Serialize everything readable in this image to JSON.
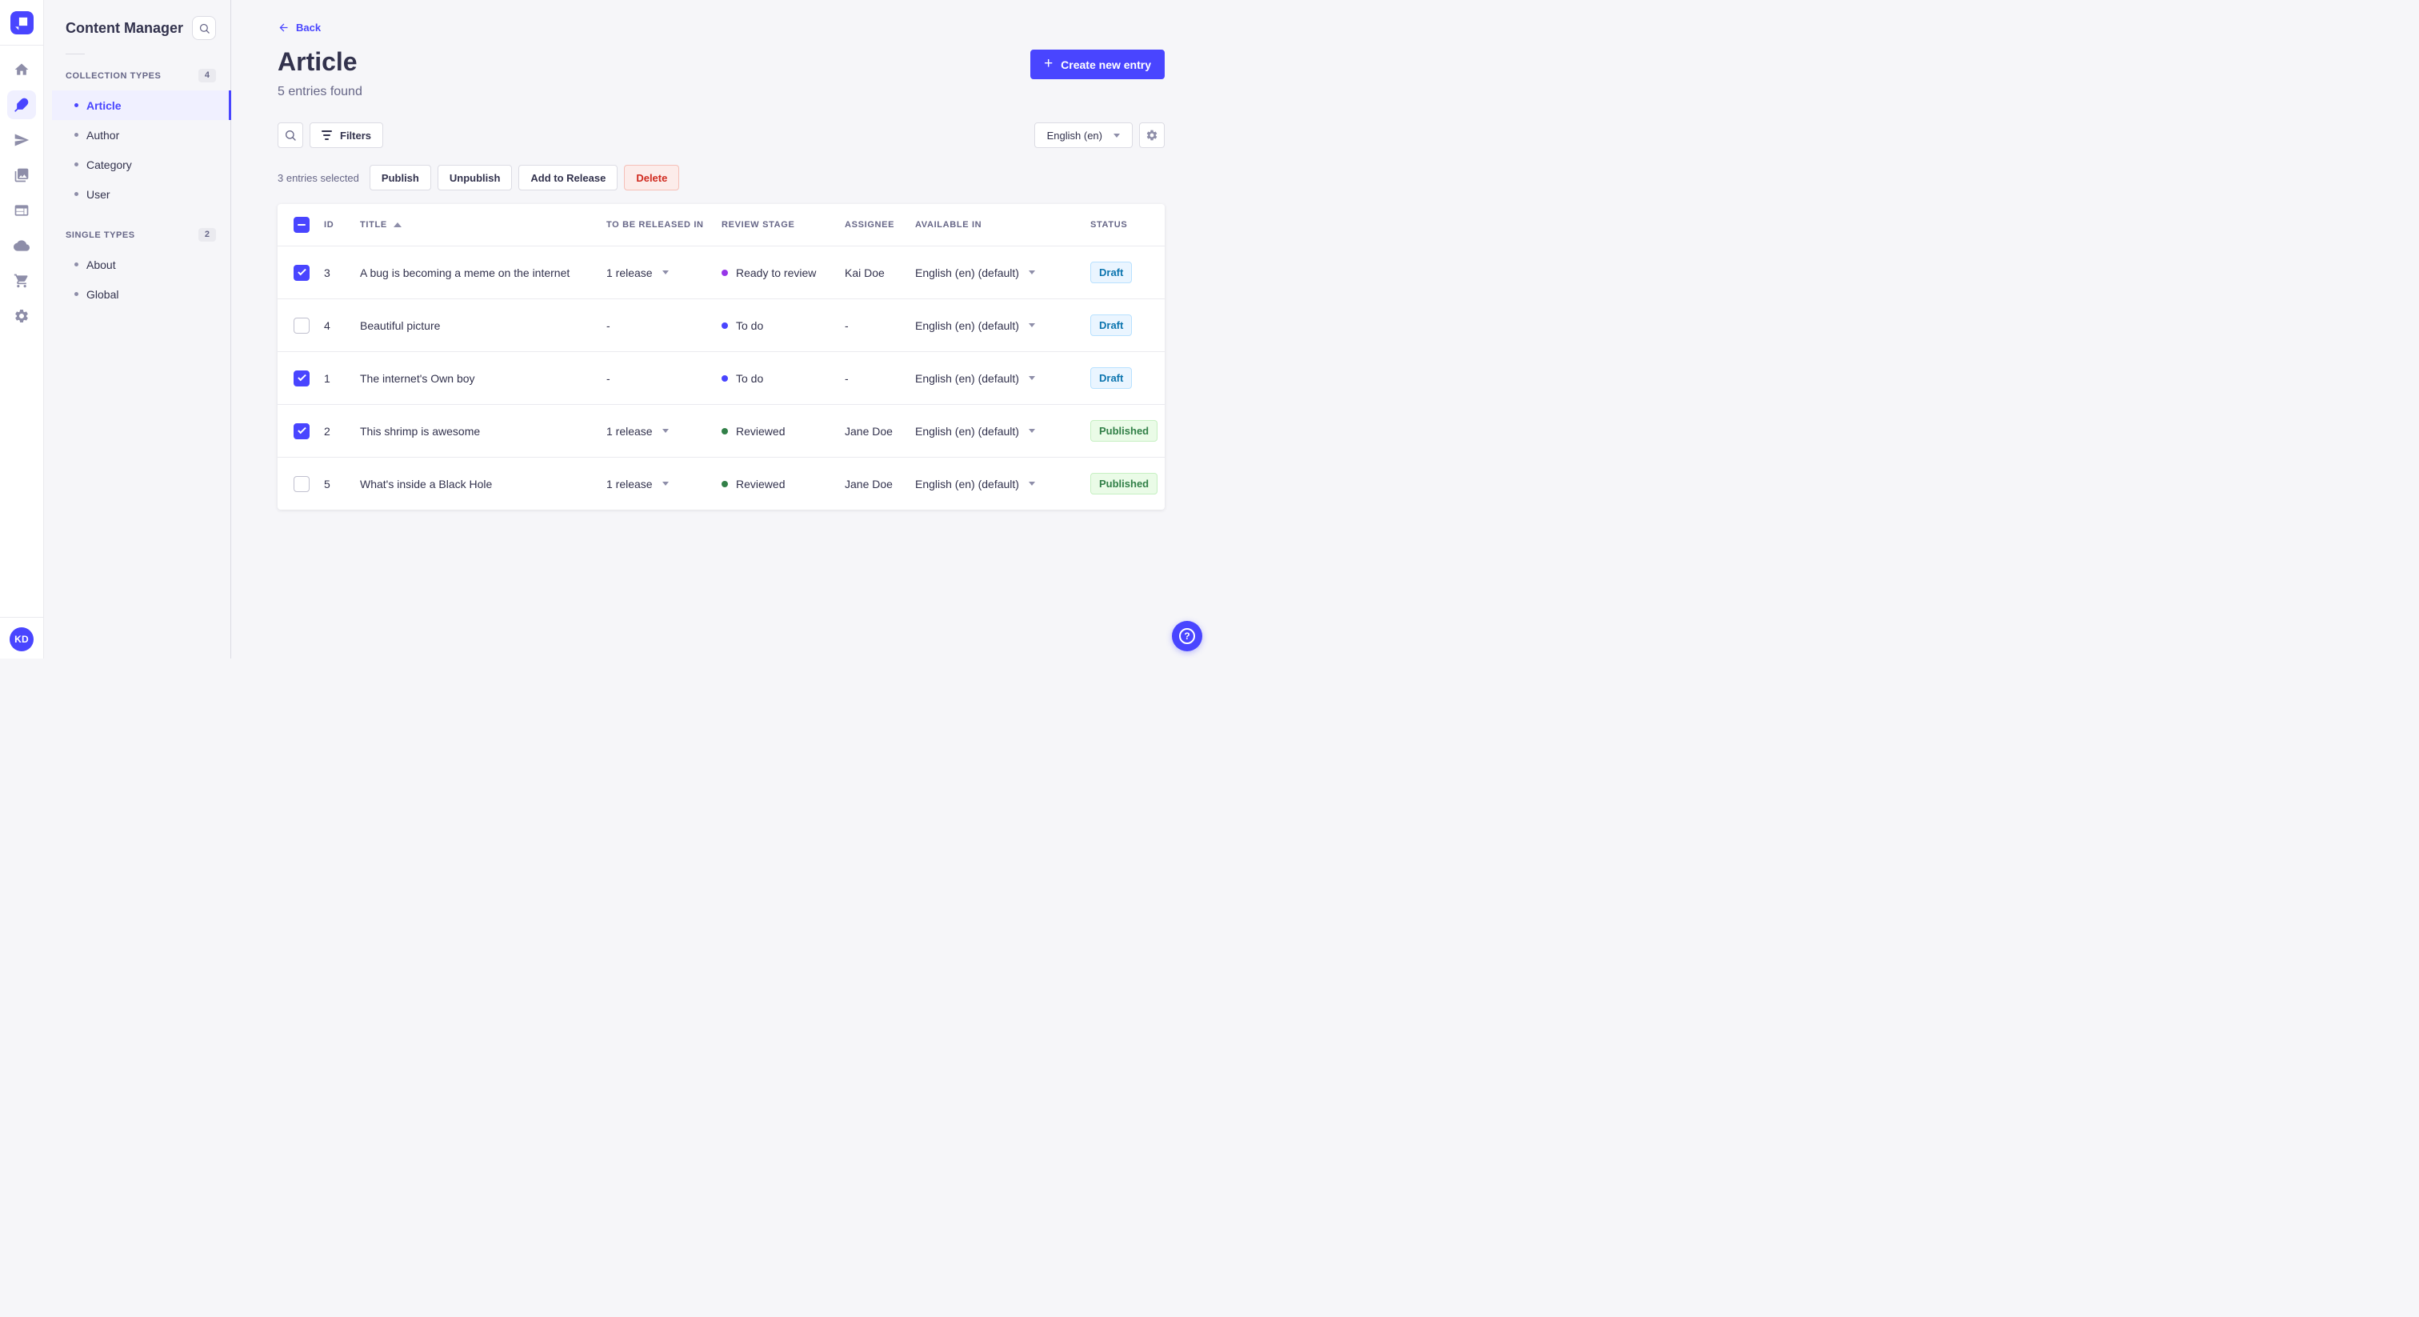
{
  "colors": {
    "primary": "#4945ff",
    "primary-bg": "#f0f0ff",
    "text": "#32324d",
    "text-muted": "#666687",
    "border": "#dcdce4",
    "border-light": "#eaeaef",
    "page-bg": "#f6f6f9",
    "danger-text": "#d02b20",
    "danger-bg": "#fcecea",
    "danger-border": "#f5c0b8",
    "draft-text": "#0c75af",
    "draft-bg": "#eaf5ff",
    "draft-border": "#b8e1ff",
    "published-text": "#328048",
    "published-bg": "#eafbe7",
    "published-border": "#c6f0c2"
  },
  "rail": {
    "items": [
      {
        "name": "home",
        "active": false
      },
      {
        "name": "content-manager",
        "active": true
      },
      {
        "name": "releases",
        "active": false
      },
      {
        "name": "media-library",
        "active": false
      },
      {
        "name": "content-type-builder",
        "active": false
      },
      {
        "name": "cloud",
        "active": false
      },
      {
        "name": "marketplace",
        "active": false
      },
      {
        "name": "settings",
        "active": false
      }
    ],
    "avatar_initials": "KD"
  },
  "subnav": {
    "title": "Content Manager",
    "sections": [
      {
        "label": "COLLECTION TYPES",
        "count": "4",
        "items": [
          {
            "label": "Article",
            "active": true
          },
          {
            "label": "Author",
            "active": false
          },
          {
            "label": "Category",
            "active": false
          },
          {
            "label": "User",
            "active": false
          }
        ]
      },
      {
        "label": "SINGLE TYPES",
        "count": "2",
        "items": [
          {
            "label": "About",
            "active": false
          },
          {
            "label": "Global",
            "active": false
          }
        ]
      }
    ]
  },
  "header": {
    "back": "Back",
    "title": "Article",
    "subtitle": "5 entries found",
    "create": "Create new entry"
  },
  "toolbar": {
    "filters": "Filters",
    "locale": "English (en)"
  },
  "selection": {
    "label": "3 entries selected",
    "publish": "Publish",
    "unpublish": "Unpublish",
    "add_to_release": "Add to Release",
    "delete": "Delete"
  },
  "table": {
    "select_all_state": "indeterminate",
    "sort": {
      "column": "TITLE",
      "direction": "asc"
    },
    "columns": {
      "id": "ID",
      "title": "TITLE",
      "release": "TO BE RELEASED IN",
      "stage": "REVIEW STAGE",
      "assignee": "ASSIGNEE",
      "available": "AVAILABLE IN",
      "status": "STATUS"
    },
    "rows": [
      {
        "checked": true,
        "id": "3",
        "title": "A bug is becoming a meme on the internet",
        "release": "1 release",
        "stage": "Ready to review",
        "stage_color": "#9736e8",
        "assignee": "Kai Doe",
        "available": "English (en) (default)",
        "status": "Draft"
      },
      {
        "checked": false,
        "id": "4",
        "title": "Beautiful picture",
        "release": "-",
        "stage": "To do",
        "stage_color": "#4945ff",
        "assignee": "-",
        "available": "English (en) (default)",
        "status": "Draft"
      },
      {
        "checked": true,
        "id": "1",
        "title": "The internet's Own boy",
        "release": "-",
        "stage": "To do",
        "stage_color": "#4945ff",
        "assignee": "-",
        "available": "English (en) (default)",
        "status": "Draft"
      },
      {
        "checked": true,
        "id": "2",
        "title": "This shrimp is awesome",
        "release": "1 release",
        "stage": "Reviewed",
        "stage_color": "#328048",
        "assignee": "Jane Doe",
        "available": "English (en) (default)",
        "status": "Published"
      },
      {
        "checked": false,
        "id": "5",
        "title": "What's inside a Black Hole",
        "release": "1 release",
        "stage": "Reviewed",
        "stage_color": "#328048",
        "assignee": "Jane Doe",
        "available": "English (en) (default)",
        "status": "Published"
      }
    ]
  },
  "fab": {
    "glyph": "?"
  }
}
